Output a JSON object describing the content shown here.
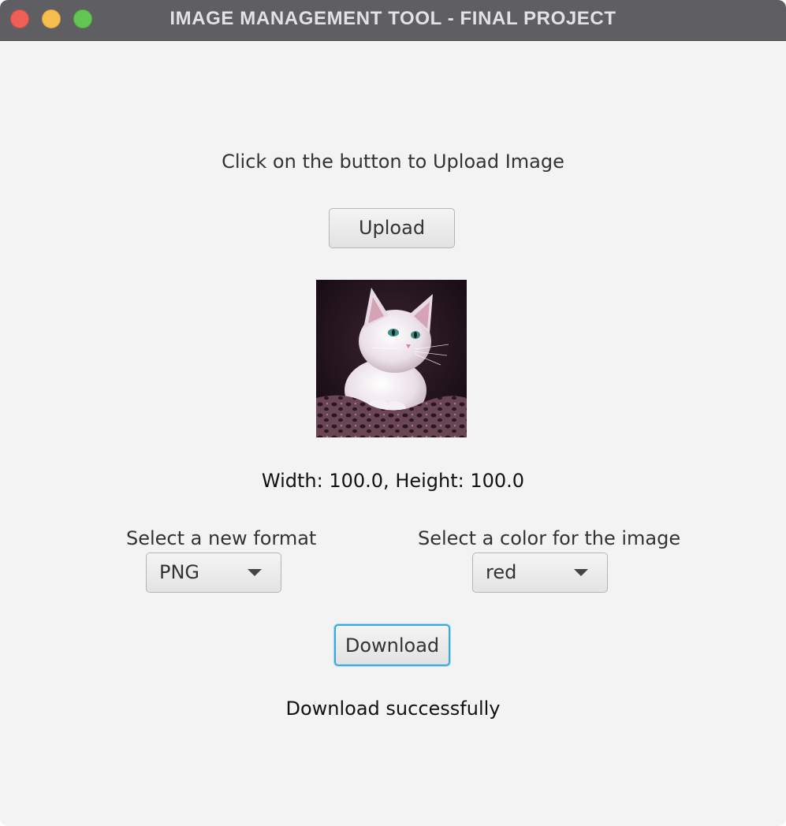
{
  "window": {
    "title": "IMAGE MANAGEMENT TOOL - FINAL PROJECT"
  },
  "upload": {
    "prompt": "Click on the button to Upload Image",
    "button_label": "Upload"
  },
  "image_preview": {
    "icon": "kitten-image",
    "dimensions_text": "Width: 100.0, Height: 100.0"
  },
  "format": {
    "label": "Select a new format",
    "selected": "PNG"
  },
  "color": {
    "label": "Select a color for the image",
    "selected": "red"
  },
  "download": {
    "button_label": "Download",
    "status_text": "Download successfully"
  },
  "colors": {
    "titlebar": "#5f5e63",
    "background": "#f3f3f3",
    "focus_ring": "#3aa9e0"
  }
}
